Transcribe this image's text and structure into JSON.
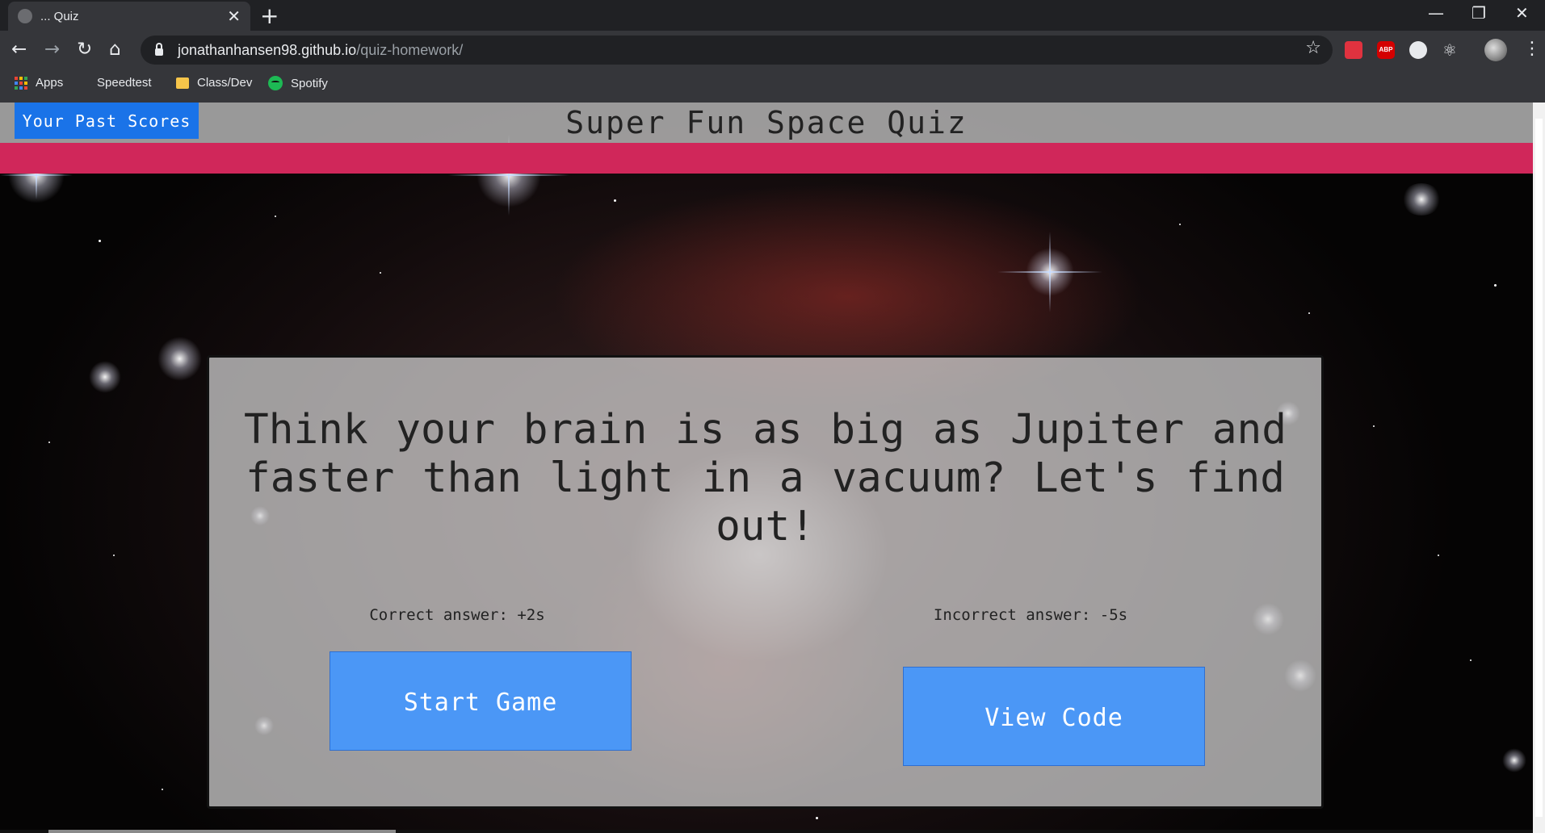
{
  "browser": {
    "tab_title": "... Quiz",
    "url_host": "jonathanhansen98.github.io",
    "url_path": "/quiz-homework/",
    "bookmarks": [
      {
        "label": "Apps",
        "icon": "apps-grid-icon"
      },
      {
        "label": "Speedtest",
        "icon": "speedtest-icon"
      },
      {
        "label": "Class/Dev",
        "icon": "folder-icon"
      },
      {
        "label": "Spotify",
        "icon": "spotify-icon"
      }
    ],
    "extensions": {
      "abp_label": "ABP"
    }
  },
  "header": {
    "past_scores_label": "Your Past Scores",
    "title": "Super Fun Space Quiz"
  },
  "card": {
    "intro": "Think your brain is as big as Jupiter and faster than light in a vacuum? Let's find out!",
    "correct_rule": "Correct answer: +2s",
    "incorrect_rule": "Incorrect answer: -5s",
    "start_label": "Start Game",
    "code_label": "View Code"
  },
  "colors": {
    "accent_bar": "#d0275a",
    "button_blue": "#4b97f6",
    "header_button": "#1a73e8"
  }
}
